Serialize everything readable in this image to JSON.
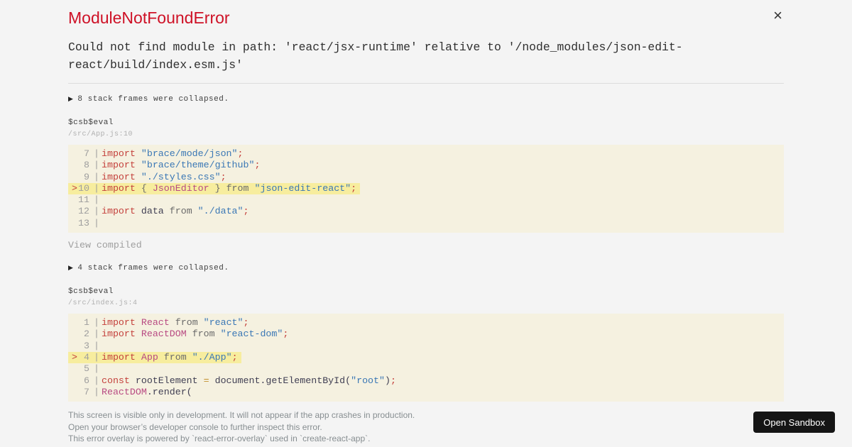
{
  "overlay": {
    "title": "ModuleNotFoundError",
    "message": "Could not find module in path: 'react/jsx-runtime' relative to '/node_modules/json-edit-react/build/index.esm.js'"
  },
  "icons": {
    "collapse_marker": "▶",
    "close": "×"
  },
  "frames": [
    {
      "collapsed_notice": "8 stack frames were collapsed.",
      "function": "$csb$eval",
      "location": "/src/App.js:10",
      "action_label": "View compiled",
      "code_lines": [
        {
          "num": "7",
          "marked": false,
          "tokens": [
            [
              "k",
              "import"
            ],
            [
              "p",
              " "
            ],
            [
              "s",
              "\"brace/mode/json\""
            ],
            [
              "k",
              ";"
            ]
          ]
        },
        {
          "num": "8",
          "marked": false,
          "tokens": [
            [
              "k",
              "import"
            ],
            [
              "p",
              " "
            ],
            [
              "s",
              "\"brace/theme/github\""
            ],
            [
              "k",
              ";"
            ]
          ]
        },
        {
          "num": "9",
          "marked": false,
          "tokens": [
            [
              "k",
              "import"
            ],
            [
              "p",
              " "
            ],
            [
              "s",
              "\"./styles.css\""
            ],
            [
              "k",
              ";"
            ]
          ]
        },
        {
          "num": "10",
          "marked": true,
          "tokens": [
            [
              "k",
              "import"
            ],
            [
              "p",
              " "
            ],
            [
              "g",
              "{"
            ],
            [
              "p",
              " "
            ],
            [
              "c",
              "JsonEditor"
            ],
            [
              "p",
              " "
            ],
            [
              "g",
              "}"
            ],
            [
              "p",
              " "
            ],
            [
              "g",
              "from"
            ],
            [
              "p",
              " "
            ],
            [
              "s",
              "\"json-edit-react\""
            ],
            [
              "k",
              ";"
            ]
          ]
        },
        {
          "num": "11",
          "marked": false,
          "tokens": []
        },
        {
          "num": "12",
          "marked": false,
          "tokens": [
            [
              "k",
              "import"
            ],
            [
              "p",
              " data "
            ],
            [
              "g",
              "from"
            ],
            [
              "p",
              " "
            ],
            [
              "s",
              "\"./data\""
            ],
            [
              "k",
              ";"
            ]
          ]
        },
        {
          "num": "13",
          "marked": false,
          "tokens": []
        }
      ]
    },
    {
      "collapsed_notice": "4 stack frames were collapsed.",
      "function": "$csb$eval",
      "location": "/src/index.js:4",
      "code_lines": [
        {
          "num": "1",
          "marked": false,
          "tokens": [
            [
              "k",
              "import"
            ],
            [
              "p",
              " "
            ],
            [
              "c",
              "React"
            ],
            [
              "p",
              " "
            ],
            [
              "g",
              "from"
            ],
            [
              "p",
              " "
            ],
            [
              "s",
              "\"react\""
            ],
            [
              "k",
              ";"
            ]
          ]
        },
        {
          "num": "2",
          "marked": false,
          "tokens": [
            [
              "k",
              "import"
            ],
            [
              "p",
              " "
            ],
            [
              "c",
              "ReactDOM"
            ],
            [
              "p",
              " "
            ],
            [
              "g",
              "from"
            ],
            [
              "p",
              " "
            ],
            [
              "s",
              "\"react-dom\""
            ],
            [
              "k",
              ";"
            ]
          ]
        },
        {
          "num": "3",
          "marked": false,
          "tokens": []
        },
        {
          "num": "4",
          "marked": true,
          "tokens": [
            [
              "k",
              "import"
            ],
            [
              "p",
              " "
            ],
            [
              "c",
              "App"
            ],
            [
              "p",
              " "
            ],
            [
              "g",
              "from"
            ],
            [
              "p",
              " "
            ],
            [
              "s",
              "\"./App\""
            ],
            [
              "k",
              ";"
            ]
          ]
        },
        {
          "num": "5",
          "marked": false,
          "tokens": []
        },
        {
          "num": "6",
          "marked": false,
          "tokens": [
            [
              "k",
              "const"
            ],
            [
              "p",
              " rootElement "
            ],
            [
              "o",
              "="
            ],
            [
              "p",
              " document.getElementById("
            ],
            [
              "s",
              "\"root\""
            ],
            [
              "p",
              ")"
            ],
            [
              "k",
              ";"
            ]
          ]
        },
        {
          "num": "7",
          "marked": false,
          "tokens": [
            [
              "c",
              "ReactDOM"
            ],
            [
              "p",
              ".render("
            ]
          ]
        }
      ]
    }
  ],
  "footer": {
    "lines": [
      "This screen is visible only in development. It will not appear if the app crashes in production.",
      "Open your browser’s developer console to further inspect this error.",
      "This error overlay is powered by `react-error-overlay` used in `create-react-app`."
    ]
  },
  "open_sandbox_label": "Open Sandbox",
  "colors": {
    "page_bg": "#f4f4f4",
    "title_red": "#ce1126",
    "code_bg": "#f5f1e0",
    "code_highlight": "#f7ed9e",
    "keyword_red": "#c4413c",
    "identifier_rose": "#b84a82",
    "string_blue": "#3a77b5",
    "operator_amber": "#c28f2c",
    "footer_gray": "#878e91",
    "button_bg": "#151515"
  }
}
